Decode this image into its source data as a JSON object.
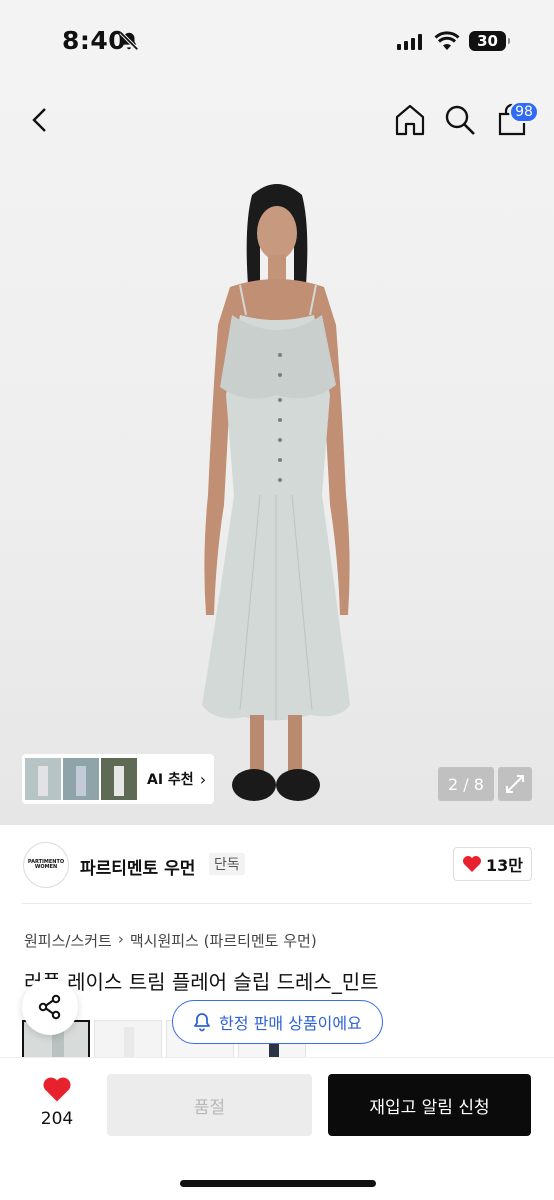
{
  "status": {
    "time": "8:40",
    "battery": "30"
  },
  "nav": {
    "cart_count": "98"
  },
  "gallery": {
    "counter": "2 / 8",
    "ai_label": "AI 추천"
  },
  "brand": {
    "logo_line1": "PARTIMENTO",
    "logo_line2": "WOMEN",
    "name": "파르티멘토 우먼",
    "tag": "단독",
    "likes": "13만"
  },
  "breadcrumb": {
    "category": "원피스/스커트",
    "sub": "맥시원피스 (파르티멘토 우먼)"
  },
  "product": {
    "title": "러플 레이스 트림 플레어 슬립 드레스_민트"
  },
  "limited_badge": "한정 판매 상품이에요",
  "bottom": {
    "fav_count": "204",
    "soldout_label": "품절",
    "restock_label": "재입고 알림 신청"
  },
  "colors": {
    "accent_blue": "#2f6bf5",
    "like_red": "#e8222c"
  }
}
